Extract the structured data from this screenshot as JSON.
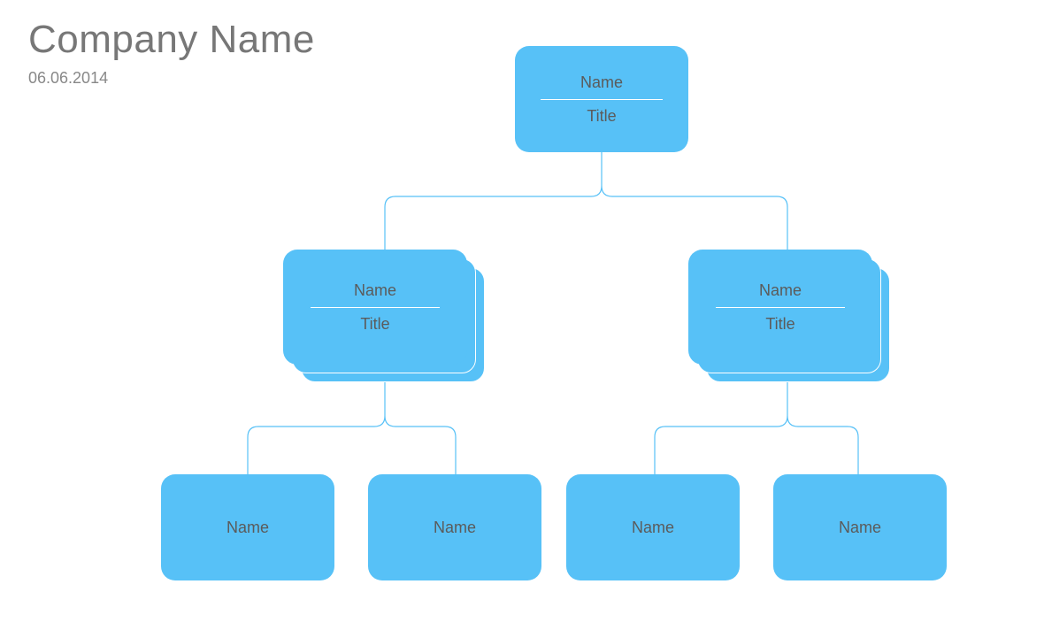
{
  "header": {
    "company": "Company Name",
    "date": "06.06.2014"
  },
  "colors": {
    "card_fill": "#57c1f7",
    "text": "#5b5b5b",
    "connector": "#57c1f7"
  },
  "tree": {
    "root": {
      "name": "Name",
      "title": "Title",
      "stacked": false,
      "children": [
        {
          "name": "Name",
          "title": "Title",
          "stacked": true,
          "children": [
            {
              "name": "Name",
              "stacked": false
            },
            {
              "name": "Name",
              "stacked": false
            }
          ]
        },
        {
          "name": "Name",
          "title": "Title",
          "stacked": true,
          "children": [
            {
              "name": "Name",
              "stacked": false
            },
            {
              "name": "Name",
              "stacked": false
            }
          ]
        }
      ]
    }
  }
}
